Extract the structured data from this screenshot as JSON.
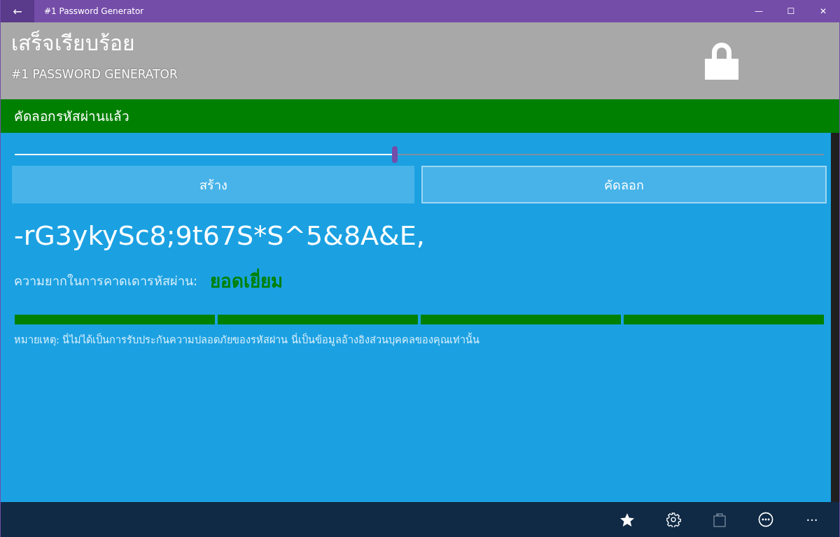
{
  "window": {
    "title": "#1 Password Generator",
    "back": "←",
    "controls": [
      "—",
      "☐",
      "✕"
    ]
  },
  "header": {
    "status": "เสร็จเรียบร้อย",
    "app_name": "#1 PASSWORD GENERATOR"
  },
  "notification": "คัดลอกรหัสผ่านแล้ว",
  "length_slider": {
    "level": 0.47
  },
  "buttons": [
    {
      "label": "สร้าง",
      "kind": "filled"
    },
    {
      "label": "คัดลอก",
      "kind": "outlined"
    }
  ],
  "password": "-rG3ykySc8;9t67S*S^5&8A&E,",
  "strength": {
    "label": "ความยากในการคาดเดารหัสผ่าน:",
    "value": "ยอดเยี่ยม",
    "color": "#008000",
    "bars": [
      {
        "filled": true
      },
      {
        "filled": true
      },
      {
        "filled": true
      },
      {
        "filled": true
      }
    ]
  },
  "note": "หมายเหตุ: นี่ไม่ได้เป็นการรับประกันความปลอดภัยของรหัสผ่าน นี่เป็นข้อมูลอ้างอิงส่วนบุคคลของคุณเท่านั้น",
  "app_bar": [
    {
      "kind": "star",
      "disabled": false
    },
    {
      "kind": "settings",
      "disabled": false
    },
    {
      "kind": "bag",
      "disabled": true
    },
    {
      "kind": "more-circle",
      "disabled": false
    },
    {
      "kind": "ellipsis",
      "label": "···",
      "disabled": false
    }
  ]
}
